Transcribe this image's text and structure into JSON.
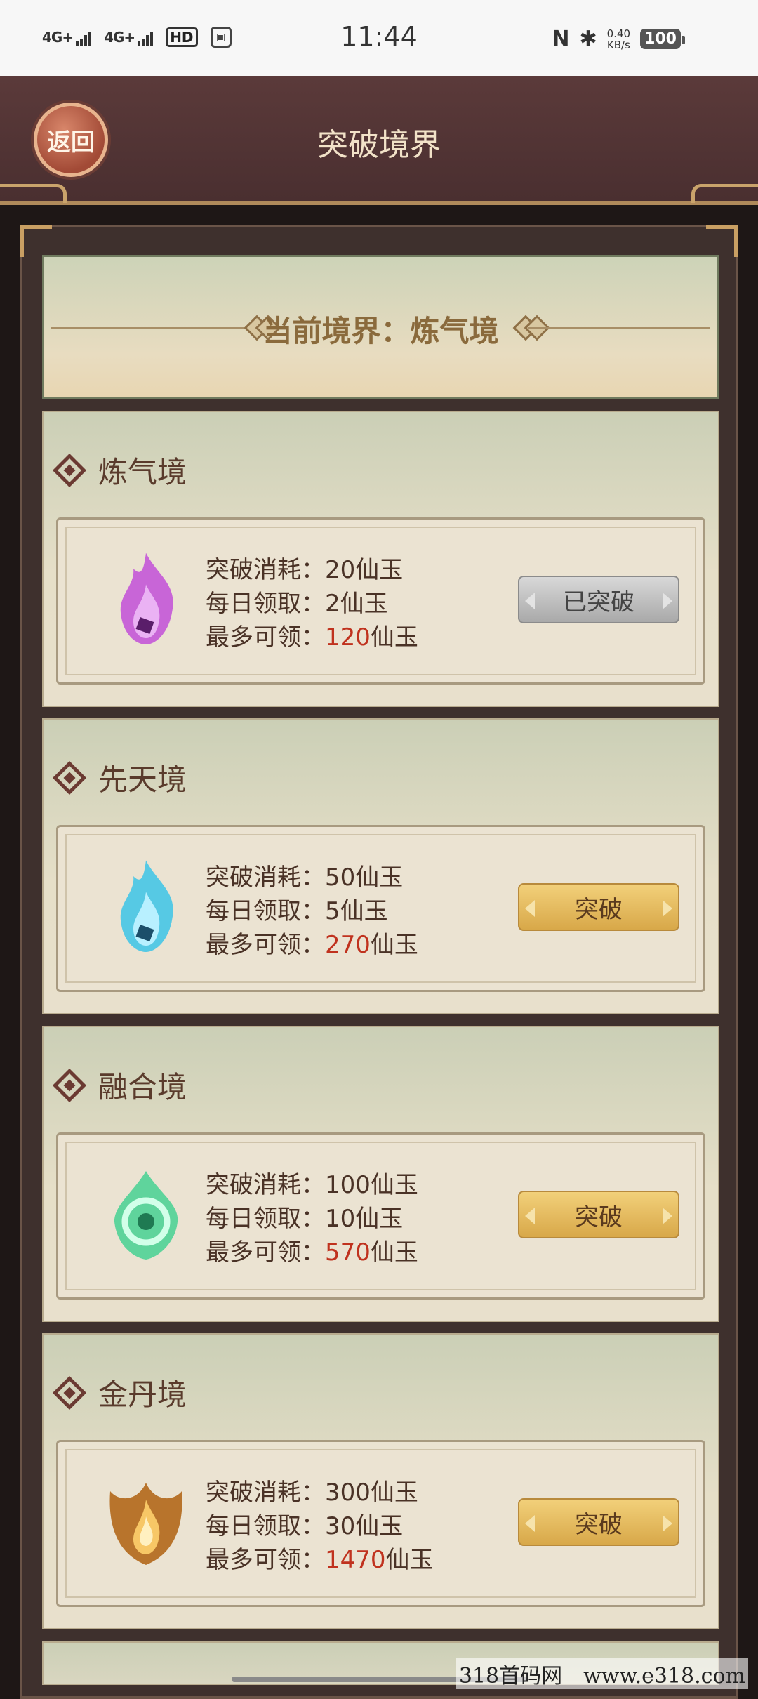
{
  "status_bar": {
    "signal1": "4G+",
    "signal2": "4G+",
    "hd": "HD",
    "time": "11:44",
    "nfc": "N",
    "bluetooth": "✱",
    "speed_value": "0.40",
    "speed_unit": "KB/s",
    "battery": "100"
  },
  "header": {
    "back_label": "返回",
    "title": "突破境界"
  },
  "current_realm": "当前境界：炼气境",
  "realms": [
    {
      "name": "炼气境",
      "cost": "突破消耗：20仙玉",
      "daily": "每日领取：2仙玉",
      "max_prefix": "最多可领：",
      "max_value": "120",
      "max_suffix": "仙玉",
      "button": "已突破",
      "flame_color": "#c24fd8"
    },
    {
      "name": "先天境",
      "cost": "突破消耗：50仙玉",
      "daily": "每日领取：5仙玉",
      "max_prefix": "最多可领：",
      "max_value": "270",
      "max_suffix": "仙玉",
      "button": "突破",
      "flame_color": "#3cc4e8"
    },
    {
      "name": "融合境",
      "cost": "突破消耗：100仙玉",
      "daily": "每日领取：10仙玉",
      "max_prefix": "最多可领：",
      "max_value": "570",
      "max_suffix": "仙玉",
      "button": "突破",
      "flame_color": "#3ccf8e"
    },
    {
      "name": "金丹境",
      "cost": "突破消耗：300仙玉",
      "daily": "每日领取：30仙玉",
      "max_prefix": "最多可领：",
      "max_value": "1470",
      "max_suffix": "仙玉",
      "button": "突破",
      "flame_color": "#d89a3c"
    }
  ],
  "watermark": "318首码网　www.e318.com"
}
